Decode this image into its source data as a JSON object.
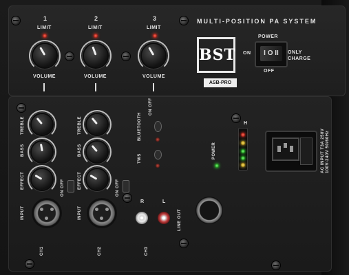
{
  "header": {
    "system_title": "MULTI-POSITION PA SYSTEM"
  },
  "brand": {
    "logo_text": "BST",
    "model": "ASB-PRO"
  },
  "volume_channels": [
    {
      "number": "1",
      "limit_label": "LIMIT",
      "volume_label": "VOLUME"
    },
    {
      "number": "2",
      "limit_label": "LIMIT",
      "volume_label": "VOLUME"
    },
    {
      "number": "3",
      "limit_label": "LIMIT",
      "volume_label": "VOLUME"
    }
  ],
  "power_switch": {
    "label": "POWER",
    "on_label": "ON",
    "off_label": "OFF",
    "only_charge_label": "ONLY CHARGE",
    "rocker_symbol": "I O II"
  },
  "eq_channels": [
    {
      "treble": "TREBLE",
      "bass": "BASS",
      "effect": "EFFECT",
      "toggle": "ON OFF",
      "input": "INPUT",
      "name": "CH1"
    },
    {
      "treble": "TREBLE",
      "bass": "BASS",
      "effect": "EFFECT",
      "toggle": "ON OFF",
      "input": "INPUT",
      "name": "CH2"
    }
  ],
  "bluetooth": {
    "label": "BLUETOOTH",
    "toggle": "ON OFF"
  },
  "tws": {
    "label": "TWS"
  },
  "power_indicator": {
    "label": "POWER"
  },
  "meter": {
    "label": "H"
  },
  "ch3": {
    "r_label": "R",
    "l_label": "L",
    "name": "CH3",
    "line_out_label": "LINE OUT"
  },
  "ac_input": {
    "label": "AC INPUT T3A 250V 100V-240V 50/60Hz"
  },
  "colors": {
    "led_red": "#ff3b2a",
    "led_green": "#3bff3b",
    "led_yellow": "#ffd93b",
    "panel": "#1e1e1e"
  }
}
